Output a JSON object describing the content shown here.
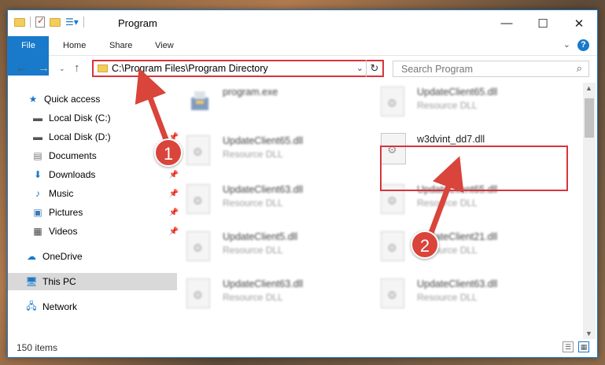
{
  "window": {
    "title": "Program",
    "minimize": "—",
    "maximize": "☐",
    "close": "✕"
  },
  "ribbon": {
    "tabs": [
      "File",
      "Home",
      "Share",
      "View"
    ],
    "help": "?"
  },
  "address": {
    "path": "C:\\Program Files\\Program Directory",
    "search_placeholder": "Search Program"
  },
  "sidebar": {
    "items": [
      {
        "label": "Quick access",
        "icon": "star-icon"
      },
      {
        "label": "Local Disk (C:)",
        "icon": "drive-icon"
      },
      {
        "label": "Local Disk (D:)",
        "icon": "drive-icon"
      },
      {
        "label": "Documents",
        "icon": "documents-icon"
      },
      {
        "label": "Downloads",
        "icon": "download-icon"
      },
      {
        "label": "Music",
        "icon": "music-icon"
      },
      {
        "label": "Pictures",
        "icon": "pictures-icon"
      },
      {
        "label": "Videos",
        "icon": "videos-icon"
      },
      {
        "label": "OneDrive",
        "icon": "cloud-icon"
      },
      {
        "label": "This PC",
        "icon": "computer-icon"
      },
      {
        "label": "Network",
        "icon": "network-icon"
      }
    ]
  },
  "files": [
    {
      "name": "program.exe",
      "type": ""
    },
    {
      "name": "UpdateClient65.dll",
      "type": "Resource DLL"
    },
    {
      "name": "UpdateClient65.dll",
      "type": "Resource DLL"
    },
    {
      "name": "w3dvint_dd7.dll",
      "type": ""
    },
    {
      "name": "UpdateClient63.dll",
      "type": "Resource DLL"
    },
    {
      "name": "UpdateClient65.dll",
      "type": "Resource DLL"
    },
    {
      "name": "UpdateClient5.dll",
      "type": "Resource DLL"
    },
    {
      "name": "UpdateClient21.dll",
      "type": "Resource DLL"
    },
    {
      "name": "UpdateClient63.dll",
      "type": "Resource DLL"
    },
    {
      "name": "UpdateClient63.dll",
      "type": "Resource DLL"
    }
  ],
  "status": {
    "count": "150 items"
  },
  "annotations": {
    "step1": "1",
    "step2": "2",
    "color": "#d9443b"
  }
}
